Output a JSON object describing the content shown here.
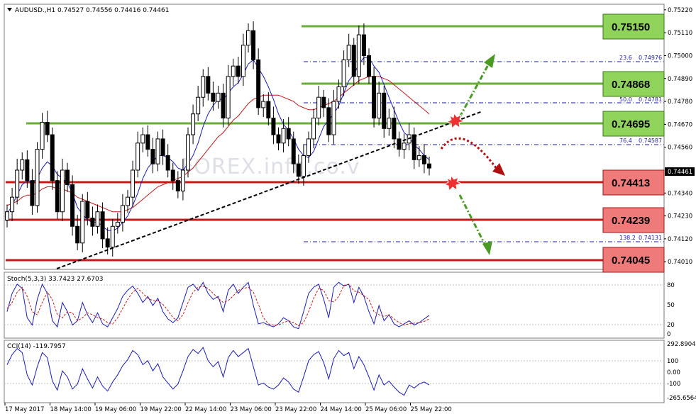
{
  "main": {
    "header": "AUDUSD.,H1  0.74527 0.74556 0.74416 0.74461",
    "watermark": "FOREX.info.co.v",
    "current_price": "0.74461",
    "y_ticks": [
      "0.75220",
      "0.75110",
      "0.75000",
      "0.74890",
      "0.74780",
      "0.74670",
      "0.74560",
      "0.74461",
      "0.74340",
      "0.74230",
      "0.74120",
      "0.74010"
    ],
    "fib_levels": [
      {
        "ratio": "23.6",
        "price": "0.74976"
      },
      {
        "ratio": "50.0",
        "price": "0.74781"
      },
      {
        "ratio": "76.4",
        "price": "0.74587"
      },
      {
        "ratio": "138.2",
        "price": "0.74131"
      }
    ],
    "resistance_levels": [
      "0.75150",
      "0.74868",
      "0.74695"
    ],
    "support_levels": [
      "0.74413",
      "0.74239",
      "0.74045"
    ],
    "colors": {
      "resistance": "#6aae3a",
      "resistance_label": "#8fd35a",
      "support": "#c41a1a",
      "support_label": "#ef7a7a",
      "bull": "#000000",
      "bear": "#000000",
      "fast_ma": "#1c1cba",
      "slow_ma": "#c41a1a",
      "trendline": "#000000"
    }
  },
  "stoch": {
    "label": "Stoch(5,3,3) 33.7423 27.6703",
    "y_ticks": [
      "80",
      "50",
      "20",
      "0"
    ]
  },
  "cci": {
    "label": "CCI(14) -119.7957",
    "y_ticks": [
      "292.8904",
      "100",
      "0.00",
      "-100",
      "-265.6564"
    ]
  },
  "x_ticks": [
    "17 May 2017",
    "18 May 14:00",
    "19 May 06:00",
    "19 May 22:00",
    "22 May 14:00",
    "23 May 06:00",
    "23 May 22:00",
    "24 May 14:00",
    "25 May 06:00",
    "25 May 22:00"
  ],
  "chart_data": {
    "type": "candlestick",
    "symbol": "AUDUSD.",
    "timeframe": "H1",
    "ohlc_header": {
      "open": 0.74527,
      "high": 0.74556,
      "low": 0.74416,
      "close": 0.74461
    },
    "ylim": [
      0.7398,
      0.7524
    ],
    "closes": [
      0.7425,
      0.7432,
      0.7445,
      0.745,
      0.744,
      0.7428,
      0.7455,
      0.7468,
      0.7462,
      0.744,
      0.7425,
      0.7445,
      0.7438,
      0.7418,
      0.741,
      0.743,
      0.7422,
      0.7418,
      0.7425,
      0.7412,
      0.7408,
      0.7418,
      0.742,
      0.7428,
      0.7432,
      0.7445,
      0.7458,
      0.7462,
      0.7455,
      0.7448,
      0.746,
      0.7452,
      0.7445,
      0.744,
      0.7435,
      0.7445,
      0.7462,
      0.7472,
      0.748,
      0.749,
      0.7482,
      0.7478,
      0.7482,
      0.747,
      0.749,
      0.7495,
      0.749,
      0.7505,
      0.7512,
      0.7498,
      0.7475,
      0.7478,
      0.747,
      0.7462,
      0.7458,
      0.7465,
      0.746,
      0.7448,
      0.7442,
      0.7452,
      0.746,
      0.747,
      0.748,
      0.7475,
      0.7462,
      0.7478,
      0.7485,
      0.7498,
      0.7505,
      0.749,
      0.751,
      0.75,
      0.749,
      0.747,
      0.7482,
      0.7465,
      0.747,
      0.746,
      0.7455,
      0.7458,
      0.7462,
      0.745,
      0.7452,
      0.7448,
      0.7446
    ],
    "fast_ma": [
      0.7424,
      0.7428,
      0.7433,
      0.7438,
      0.744,
      0.7439,
      0.7441,
      0.7446,
      0.7449,
      0.7447,
      0.7443,
      0.7441,
      0.7439,
      0.7434,
      0.7427,
      0.7424,
      0.7421,
      0.742,
      0.742,
      0.7418,
      0.7416,
      0.7416,
      0.7417,
      0.742,
      0.7423,
      0.7428,
      0.7434,
      0.7441,
      0.7446,
      0.7449,
      0.7452,
      0.7452,
      0.7451,
      0.7449,
      0.7446,
      0.7445,
      0.7448,
      0.7452,
      0.7458,
      0.7466,
      0.7472,
      0.7476,
      0.7479,
      0.7479,
      0.7482,
      0.7485,
      0.7487,
      0.7491,
      0.7496,
      0.7498,
      0.7494,
      0.749,
      0.7485,
      0.7479,
      0.7472,
      0.7467,
      0.7464,
      0.746,
      0.7455,
      0.7452,
      0.7451,
      0.7454,
      0.746,
      0.7466,
      0.7469,
      0.7472,
      0.7476,
      0.7482,
      0.7488,
      0.7491,
      0.7496,
      0.7499,
      0.7499,
      0.7495,
      0.7492,
      0.7486,
      0.748,
      0.7474,
      0.7468,
      0.7463,
      0.7461,
      0.7457,
      0.7455,
      0.7452,
      0.745
    ],
    "slow_ma": [
      0.7428,
      0.7429,
      0.743,
      0.7432,
      0.7433,
      0.7433,
      0.7434,
      0.7436,
      0.7437,
      0.7437,
      0.7436,
      0.7436,
      0.7435,
      0.7434,
      0.7432,
      0.7431,
      0.743,
      0.7429,
      0.7428,
      0.7427,
      0.7426,
      0.7425,
      0.7425,
      0.7425,
      0.7426,
      0.7427,
      0.7429,
      0.7431,
      0.7433,
      0.7435,
      0.7437,
      0.7438,
      0.7439,
      0.744,
      0.7441,
      0.7442,
      0.7444,
      0.7446,
      0.7449,
      0.7452,
      0.7455,
      0.7458,
      0.7461,
      0.7463,
      0.7466,
      0.7469,
      0.7471,
      0.7474,
      0.7477,
      0.7479,
      0.748,
      0.7481,
      0.7481,
      0.7481,
      0.7481,
      0.748,
      0.7479,
      0.7478,
      0.7476,
      0.7475,
      0.7474,
      0.7474,
      0.7475,
      0.7476,
      0.7477,
      0.7478,
      0.748,
      0.7482,
      0.7484,
      0.7486,
      0.7488,
      0.7489,
      0.749,
      0.749,
      0.749,
      0.7489,
      0.7488,
      0.7486,
      0.7484,
      0.7482,
      0.748,
      0.7478,
      0.7476,
      0.7474,
      0.7472
    ],
    "stoch_k": [
      40,
      70,
      85,
      78,
      30,
      18,
      60,
      85,
      70,
      25,
      15,
      55,
      40,
      18,
      25,
      55,
      35,
      22,
      38,
      20,
      15,
      30,
      45,
      65,
      75,
      82,
      70,
      55,
      65,
      50,
      62,
      40,
      28,
      22,
      30,
      55,
      80,
      85,
      75,
      88,
      70,
      60,
      65,
      40,
      75,
      85,
      70,
      80,
      88,
      50,
      20,
      22,
      18,
      15,
      20,
      30,
      25,
      15,
      12,
      40,
      70,
      80,
      85,
      60,
      30,
      80,
      88,
      82,
      85,
      55,
      80,
      65,
      40,
      20,
      50,
      25,
      35,
      20,
      15,
      20,
      25,
      18,
      22,
      28,
      34
    ],
    "stoch_d": [
      45,
      55,
      72,
      80,
      65,
      40,
      35,
      55,
      72,
      60,
      35,
      30,
      40,
      38,
      25,
      30,
      38,
      35,
      30,
      28,
      22,
      20,
      30,
      45,
      60,
      72,
      78,
      70,
      62,
      58,
      58,
      52,
      42,
      30,
      25,
      35,
      55,
      72,
      80,
      82,
      78,
      70,
      62,
      55,
      58,
      66,
      75,
      78,
      80,
      72,
      52,
      30,
      20,
      18,
      18,
      22,
      25,
      22,
      17,
      22,
      40,
      62,
      78,
      75,
      58,
      56,
      65,
      83,
      85,
      74,
      72,
      66,
      60,
      40,
      35,
      32,
      35,
      28,
      22,
      18,
      20,
      21,
      22,
      24,
      28
    ],
    "cci": [
      80,
      180,
      240,
      200,
      -20,
      -120,
      60,
      200,
      150,
      -80,
      -170,
      20,
      -40,
      -160,
      -110,
      40,
      -60,
      -150,
      -40,
      -130,
      -180,
      -90,
      -20,
      70,
      130,
      220,
      180,
      80,
      120,
      20,
      90,
      -40,
      -100,
      -160,
      -110,
      20,
      160,
      230,
      190,
      250,
      120,
      60,
      110,
      -40,
      150,
      220,
      160,
      200,
      240,
      60,
      -120,
      -100,
      -140,
      -160,
      -120,
      -50,
      -90,
      -160,
      -190,
      -40,
      120,
      180,
      210,
      100,
      -60,
      140,
      220,
      170,
      200,
      40,
      160,
      80,
      -40,
      -170,
      -20,
      -120,
      -80,
      -140,
      -190,
      -220,
      -120,
      -150,
      -110,
      -90,
      -120
    ]
  }
}
